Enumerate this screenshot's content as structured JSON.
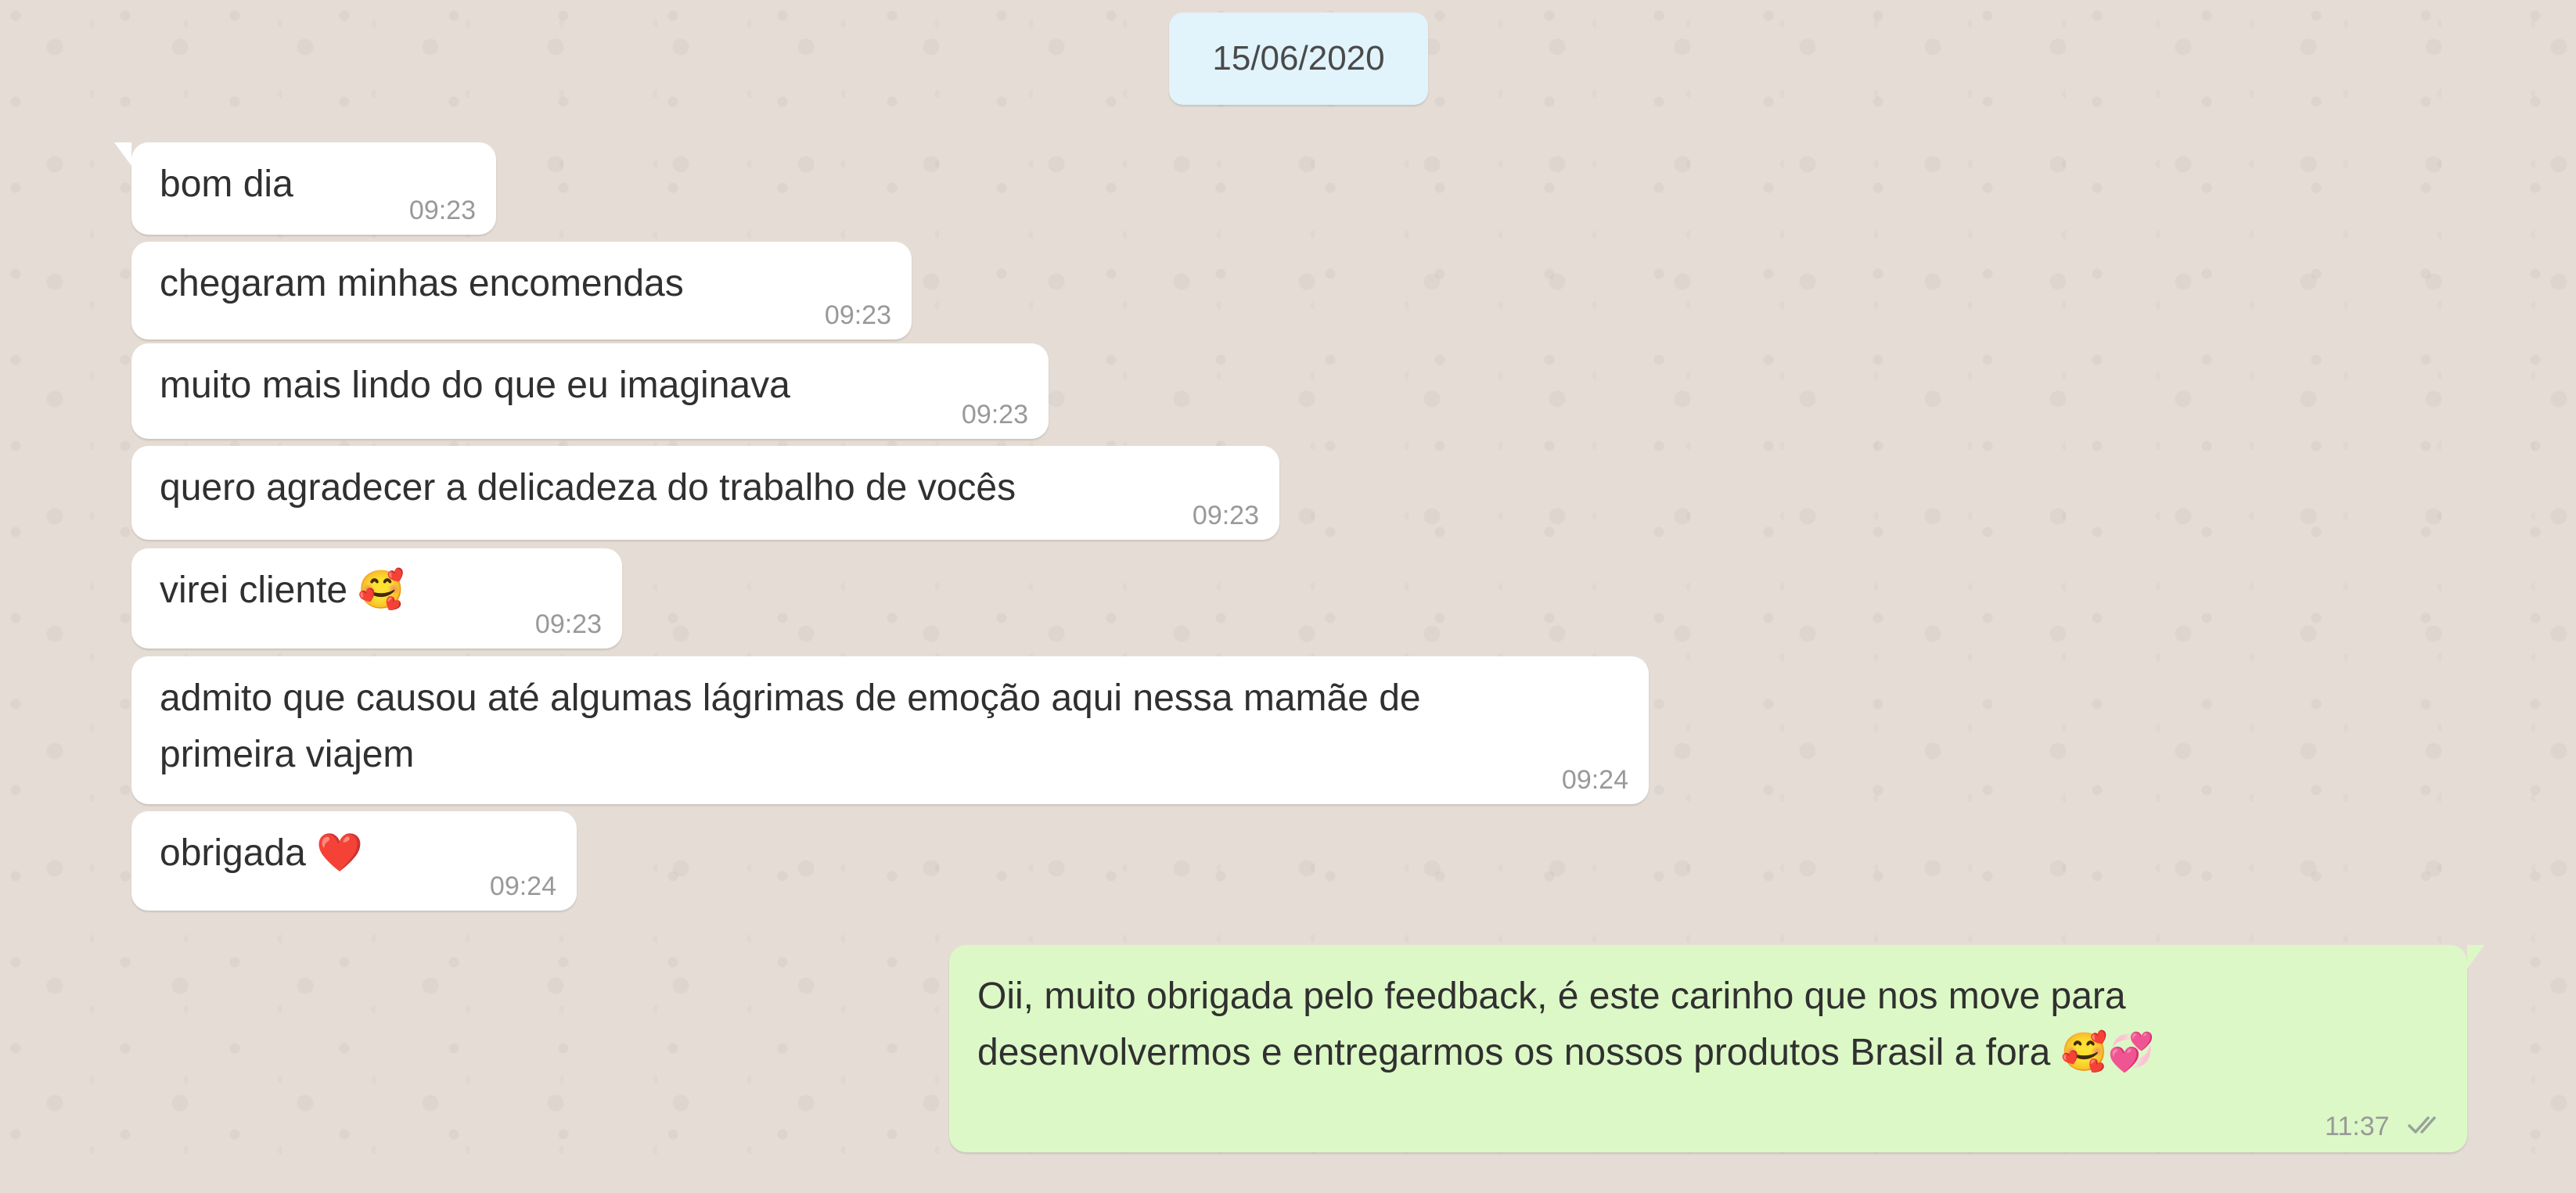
{
  "date_chip": "15/06/2020",
  "messages": [
    {
      "text": "bom dia",
      "time": "09:23"
    },
    {
      "text": "chegaram minhas encomendas",
      "time": "09:23"
    },
    {
      "text": "muito mais lindo do que eu imaginava",
      "time": "09:23"
    },
    {
      "text": "quero agradecer a delicadeza do trabalho de vocês",
      "time": "09:23"
    },
    {
      "text": "virei cliente 🥰",
      "time": "09:23"
    },
    {
      "text": "admito que causou até algumas lágrimas de emoção aqui nessa mamãe de\nprimeira viajem",
      "time": "09:24"
    },
    {
      "text": "obrigada ❤️",
      "time": "09:24"
    },
    {
      "text": "Oii, muito obrigada pelo feedback, é este carinho que nos move para\ndesenvolvermos e entregarmos os nossos produtos Brasil a fora 🥰💞",
      "time": "11:37"
    }
  ],
  "status_icon": "double-check-icon",
  "colors": {
    "background": "#e5ddd5",
    "incoming_bubble": "#ffffff",
    "outgoing_bubble": "#dcf8c6",
    "date_chip": "#e1f3fb",
    "timestamp": "#999999"
  }
}
